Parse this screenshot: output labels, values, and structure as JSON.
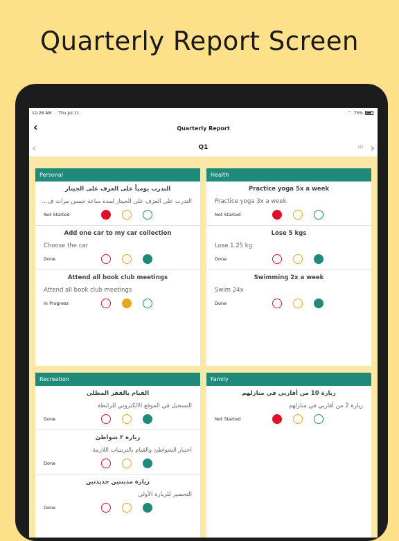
{
  "headline": "Quarterly Report Screen",
  "status_bar": {
    "time": "11:28 AM",
    "date": "Thu Jul 11",
    "battery": "75%"
  },
  "nav": {
    "title": "Quarterly Report"
  },
  "quarter": {
    "current": "Q1",
    "next": "Q2"
  },
  "colors": {
    "accent": "#1f8a7a",
    "red": "#e0102a",
    "yellow": "#e3a81d",
    "background": "#fde08a"
  },
  "panels": [
    {
      "title": "Personal",
      "goals": [
        {
          "title": "التدرب يومياً على العزف على الجيتار",
          "sub": "التدرب على العزف على الجيتار لمدة ساعة خمس مرات ف...",
          "status": "Not Started",
          "active": "red"
        },
        {
          "title": "Add one car to my car collection",
          "sub": "Choose the car",
          "status": "Done",
          "active": "green"
        },
        {
          "title": "Attend all book club meetings",
          "sub": "Attend all book club meetings",
          "status": "In Progress",
          "active": "yellow"
        }
      ]
    },
    {
      "title": "Health",
      "goals": [
        {
          "title": "Practice yoga 5x a week",
          "sub": "Practice yoga 3x a week",
          "status": "Not Started",
          "active": "red"
        },
        {
          "title": "Lose 5 kgs",
          "sub": "Lose 1.25 kg",
          "status": "Done",
          "active": "green"
        },
        {
          "title": "Swimming 2x a week",
          "sub": "Swim 24x",
          "status": "Done",
          "active": "green"
        }
      ]
    },
    {
      "title": "Recreation",
      "goals": [
        {
          "title": "القيام بالقفز المظلي",
          "sub": "التسجيل في الموقع الالكتروني للرابطة",
          "status": "Done",
          "active": "green"
        },
        {
          "title": "زيارة ٣ شواطئ",
          "sub": "اختيار الشواطئ والقيام بالترتيبات اللازمة",
          "status": "Done",
          "active": "green"
        },
        {
          "title": "زيارة مدينتين جديدتين",
          "sub": "التحضير للزيارة الأولى",
          "status": "Done",
          "active": "green"
        }
      ]
    },
    {
      "title": "Family",
      "goals": [
        {
          "title": "زيارة 10 من أقاربي في منازلهم",
          "sub": "زيارة 2 من أقاربي في منازلهم",
          "status": "Not Started",
          "active": "red"
        }
      ]
    }
  ]
}
